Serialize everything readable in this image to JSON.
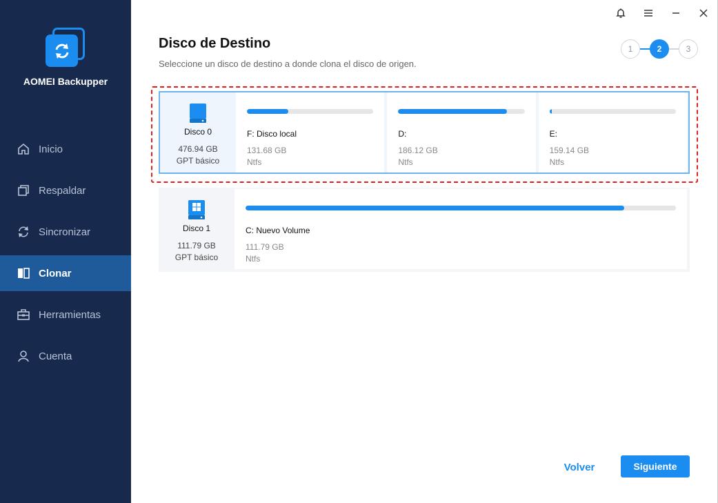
{
  "app": {
    "name": "AOMEI Backupper"
  },
  "sidebar": {
    "items": [
      {
        "label": "Inicio",
        "icon": "home-icon",
        "active": false
      },
      {
        "label": "Respaldar",
        "icon": "backup-icon",
        "active": false
      },
      {
        "label": "Sincronizar",
        "icon": "sync-icon",
        "active": false
      },
      {
        "label": "Clonar",
        "icon": "clone-icon",
        "active": true
      },
      {
        "label": "Herramientas",
        "icon": "toolbox-icon",
        "active": false
      },
      {
        "label": "Cuenta",
        "icon": "user-icon",
        "active": false
      }
    ]
  },
  "topbar": {
    "icons": [
      "bell-icon",
      "menu-icon",
      "minimize-icon",
      "close-icon"
    ]
  },
  "page": {
    "title": "Disco de Destino",
    "subtitle": "Seleccione un disco de destino a donde clona el disco de origen."
  },
  "steps": [
    "1",
    "2",
    "3"
  ],
  "active_step": 2,
  "disks": [
    {
      "name": "Disco 0",
      "size": "476.94 GB",
      "type": "GPT básico",
      "selected": true,
      "partitions": [
        {
          "name": "F: Disco local",
          "size": "131.68 GB",
          "fs": "Ntfs",
          "used_pct": 33
        },
        {
          "name": "D:",
          "size": "186.12 GB",
          "fs": "Ntfs",
          "used_pct": 86
        },
        {
          "name": "E:",
          "size": "159.14 GB",
          "fs": "Ntfs",
          "used_pct": 2
        }
      ]
    },
    {
      "name": "Disco 1",
      "size": "111.79 GB",
      "type": "GPT básico",
      "selected": false,
      "partitions": [
        {
          "name": "C: Nuevo Volume",
          "size": "111.79 GB",
          "fs": "Ntfs",
          "used_pct": 88
        }
      ]
    }
  ],
  "buttons": {
    "back": "Volver",
    "next": "Siguiente"
  },
  "colors": {
    "accent": "#1b8cf0",
    "sidebar": "#172a4d",
    "sidebar_active": "#1f5b9b",
    "highlight": "#e02020"
  }
}
